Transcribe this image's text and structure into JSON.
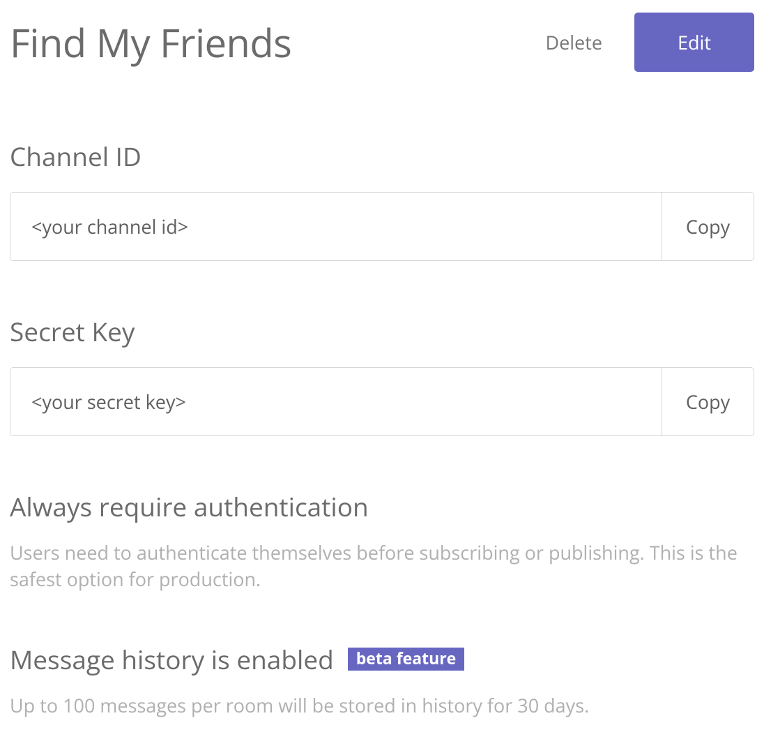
{
  "header": {
    "title": "Find My Friends",
    "delete_label": "Delete",
    "edit_label": "Edit"
  },
  "channel_id": {
    "label": "Channel ID",
    "value": "<your channel id>",
    "copy_label": "Copy"
  },
  "secret_key": {
    "label": "Secret Key",
    "value": "<your secret key>",
    "copy_label": "Copy"
  },
  "auth_section": {
    "title": "Always require authentication",
    "description": "Users need to authenticate themselves before subscribing or publishing. This is the safest option for production."
  },
  "history_section": {
    "title": "Message history is enabled",
    "badge": "beta feature",
    "description": "Up to 100 messages per room will be stored in history for 30 days."
  },
  "colors": {
    "accent": "#6767c2",
    "text_primary": "#6b6b6b",
    "text_muted": "#b0b0b0",
    "border": "#d6d6d6"
  }
}
